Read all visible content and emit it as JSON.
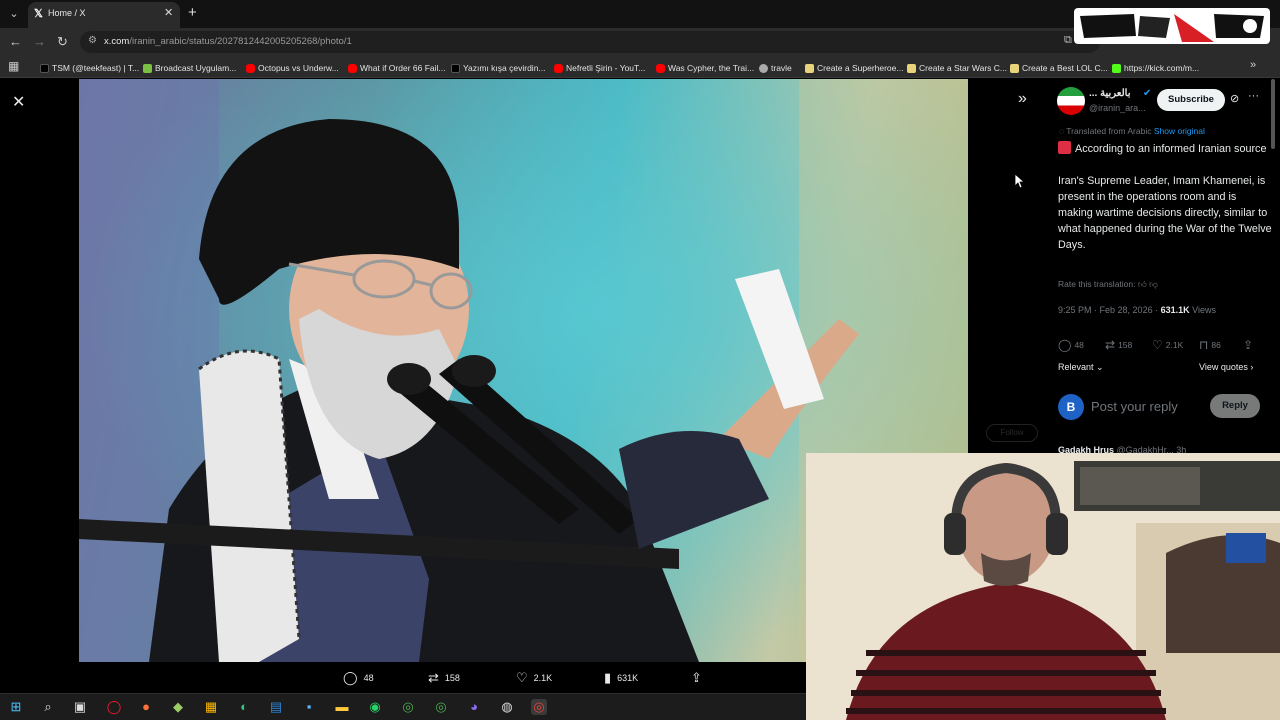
{
  "browser": {
    "tab": {
      "title": "Home / X",
      "favicon": "𝕏"
    },
    "url": {
      "host": "x.com",
      "path": "/iranin_arabic/status/2027812442005205268/photo/1"
    },
    "bookmarks": [
      {
        "label": "TSM (@teekfeast) | T...",
        "color": "#000000"
      },
      {
        "label": "Broadcast Uygulam...",
        "color": "#7ac143"
      },
      {
        "label": "Octopus vs Underw...",
        "color": "#ff0000"
      },
      {
        "label": "What if Order 66 Fail...",
        "color": "#ff0000"
      },
      {
        "label": "Yazımı kışa çevirdin...",
        "color": "#000000"
      },
      {
        "label": "Nefretli Şirin - YouT...",
        "color": "#ff0000"
      },
      {
        "label": "Was Cypher, the Trai...",
        "color": "#ff0000"
      },
      {
        "label": "travle",
        "color": "#aaaaaa"
      },
      {
        "label": "Create a Superheroe...",
        "color": "#e8d27a"
      },
      {
        "label": "Create a Star Wars C...",
        "color": "#e8d27a"
      },
      {
        "label": "Create a Best LOL C...",
        "color": "#e8d27a"
      },
      {
        "label": "https://kick.com/m...",
        "color": "#53fc18"
      }
    ]
  },
  "photo_viewer": {
    "stats": {
      "replies": "48",
      "reposts": "158",
      "likes": "2.1K",
      "views": "631K"
    }
  },
  "tweet": {
    "author_name": "... بالعربية",
    "author_handle": "@iranin_ara...",
    "subscribe_label": "Subscribe",
    "translated_label": "Translated from Arabic",
    "show_original_label": "Show original",
    "paragraph_1": "According to an informed Iranian source",
    "paragraph_2": "Iran's Supreme Leader, Imam Khamenei, is present in the operations room and is making wartime decisions directly, similar to what happened during the War of the Twelve Days.",
    "rate_label": "Rate this translation:",
    "time": "9:25 PM",
    "date": "Feb 28, 2026",
    "views_count": "631.1K",
    "views_label": "Views",
    "replies": "48",
    "reposts": "158",
    "likes": "2.1K",
    "bookmarks": "86",
    "sort_label": "Relevant",
    "view_quotes_label": "View quotes",
    "reply_avatar_letter": "B",
    "reply_placeholder": "Post your reply",
    "reply_button_label": "Reply",
    "next_reply_name": "Gadakh Hrus",
    "next_reply_handle": "@GadakhHr...",
    "next_reply_time": "3h"
  },
  "ghost_follow_label": "Follow",
  "colors": {
    "x_blue": "#1d9bf0",
    "background": "#000000",
    "muted": "#71767b"
  },
  "taskbar_icons": [
    "windows-start",
    "search",
    "task-view",
    "opera",
    "firefox",
    "app",
    "store",
    "edge",
    "app",
    "app",
    "file-explorer",
    "whatsapp",
    "chrome",
    "chrome",
    "discord",
    "app",
    "chrome"
  ]
}
